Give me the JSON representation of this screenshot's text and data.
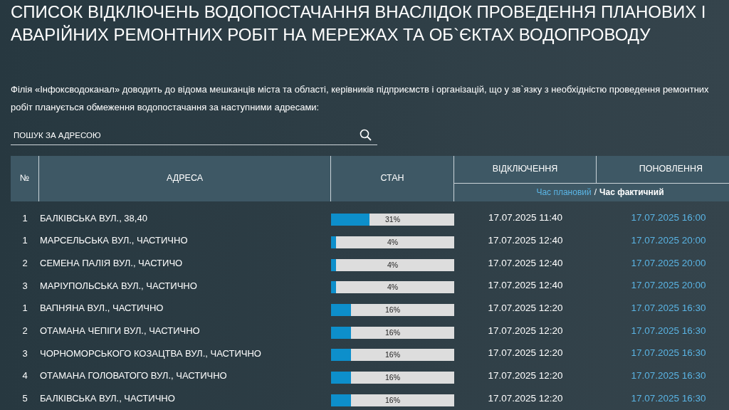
{
  "title": "СПИСОК ВІДКЛЮЧЕНЬ ВОДОПОСТАЧАННЯ ВНАСЛІДОК ПРОВЕДЕННЯ ПЛАНОВИХ І АВАРІЙНИХ РЕМОНТНИХ РОБІТ НА МЕРЕЖАХ ТА ОБ`ЄКТАХ ВОДОПРОВОДУ",
  "intro": "Філія «Інфоксводоканал» доводить до відома мешканців міста та області, керівників підприємств і організацій, що у зв`язку з необхідністю проведення ремонтних робіт планується обмеження водопостачання за наступними адресами:",
  "search": {
    "placeholder": "ПОШУК ЗА АДРЕСОЮ"
  },
  "table": {
    "columns": [
      "№",
      "АДРЕСА",
      "СТАН",
      "ВІДКЛЮЧЕННЯ",
      "ПОНОВЛЕННЯ"
    ],
    "legend": {
      "planned": "Час плановий",
      "separator": "/",
      "actual": "Час фактичний"
    },
    "rows": [
      {
        "number": "1",
        "address": "БАЛКІВСЬКА ВУЛ., 38,40",
        "level": 0.31,
        "progress": "31%",
        "off": "17.07.2025 11:40",
        "restore": "17.07.2025 16:00"
      },
      {
        "number": "1",
        "address": "МАРСЕЛЬСЬКА ВУЛ., ЧАСТИЧНО",
        "level": 0.04,
        "progress": "4%",
        "off": "17.07.2025 12:40",
        "restore": "17.07.2025 20:00"
      },
      {
        "number": "2",
        "address": "СЕМЕНА ПАЛІЯ ВУЛ., ЧАСТИЧО",
        "level": 0.04,
        "progress": "4%",
        "off": "17.07.2025 12:40",
        "restore": "17.07.2025 20:00"
      },
      {
        "number": "3",
        "address": "МАРІУПОЛЬСЬКА ВУЛ., ЧАСТИЧНО",
        "level": 0.04,
        "progress": "4%",
        "off": "17.07.2025 12:40",
        "restore": "17.07.2025 20:00"
      },
      {
        "number": "1",
        "address": "ВАПНЯНА ВУЛ., ЧАСТИЧНО",
        "level": 0.16,
        "progress": "16%",
        "off": "17.07.2025 12:20",
        "restore": "17.07.2025 16:30"
      },
      {
        "number": "2",
        "address": "ОТАМАНА ЧЕПІГИ ВУЛ., ЧАСТИЧНО",
        "level": 0.16,
        "progress": "16%",
        "off": "17.07.2025 12:20",
        "restore": "17.07.2025 16:30"
      },
      {
        "number": "3",
        "address": "ЧОРНОМОРСЬКОГО КОЗАЦТВА ВУЛ., ЧАСТИЧНО",
        "level": 0.16,
        "progress": "16%",
        "off": "17.07.2025 12:20",
        "restore": "17.07.2025 16:30"
      },
      {
        "number": "4",
        "address": "ОТАМАНА ГОЛОВАТОГО ВУЛ., ЧАСТИЧНО",
        "level": 0.16,
        "progress": "16%",
        "off": "17.07.2025 12:20",
        "restore": "17.07.2025 16:30"
      },
      {
        "number": "5",
        "address": "БАЛКІВСЬКА ВУЛ., ЧАСТИЧНО",
        "level": 0.16,
        "progress": "16%",
        "off": "17.07.2025 12:20",
        "restore": "17.07.2025 16:30"
      }
    ]
  }
}
